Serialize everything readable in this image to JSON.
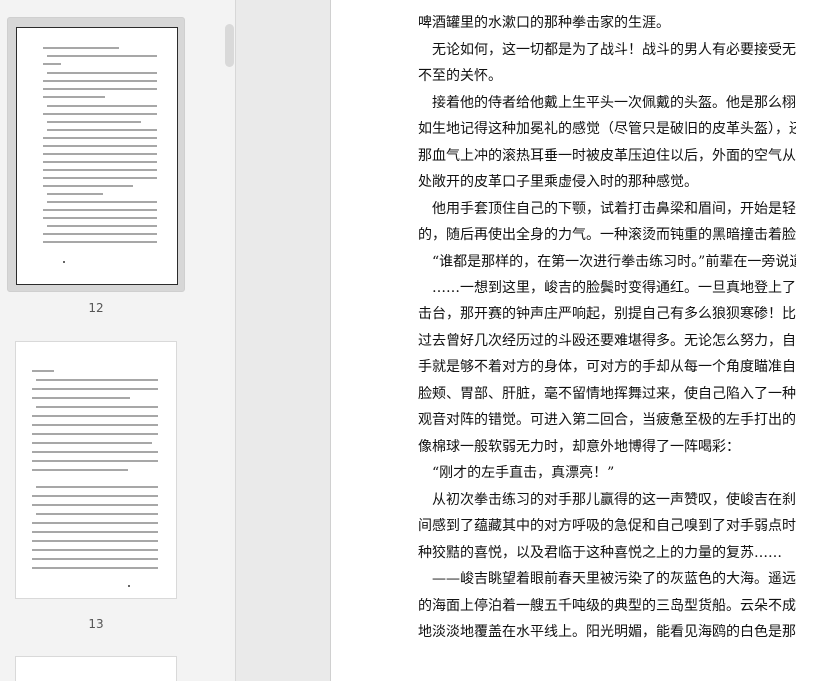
{
  "thumbnails": [
    {
      "label": "12",
      "selected": true
    },
    {
      "label": "13",
      "selected": false
    }
  ],
  "document": {
    "lines": [
      "啤酒罐里的水漱口的那种拳击家的生涯。",
      "　无论如何，这一切都是为了战斗！战斗的男人有必要接受无微",
      "不至的关怀。",
      "　接着他的侍者给他戴上生平头一次佩戴的头盔。他是那么栩栩",
      "如生地记得这种加冕礼的感觉（尽管只是破旧的皮革头盔），还有当",
      "那血气上冲的滚热耳垂一时被皮革压迫住以后，外面的空气从耳朵",
      "处敞开的皮革口子里乘虚侵入时的那种感觉。",
      "　他用手套顶住自己的下颚，试着打击鼻梁和眉间，开始是轻轻",
      "的，随后再使出全身的力气。一种滚烫而钝重的黑暗撞击着脸颊。",
      "　“谁都是那样的，在第一次进行拳击练习时。”前辈在一旁说道。",
      "　……一想到这里，峻吉的脸鬓时变得通红。一旦真地登上了拳",
      "击台，那开赛的钟声庄严响起，别提自己有多么狼狈寒碜！比自己",
      "过去曾好几次经历过的斗殴还要难堪得多。无论怎么努力，自己的",
      "手就是够不着对方的身体，可对方的手却从每一个角度瞄准自己的",
      "脸颊、胃部、肝脏，毫不留情地挥舞过来，使自己陷入了一种与千手",
      "观音对阵的错觉。可进入第二回合，当疲惫至极的左手打出的直击",
      "像棉球一般软弱无力时，却意外地博得了一阵喝彩：",
      "　“刚才的左手直击，真漂亮！”",
      "　从初次拳击练习的对手那儿赢得的这一声赞叹，使峻吉在刹那",
      "间感到了蕴藏其中的对方呼吸的急促和自己嗅到了对手弱点时的那",
      "种狡黠的喜悦，以及君临于这种喜悦之上的力量的复苏……",
      "　——峻吉眺望着眼前春天里被污染了的灰蓝色的大海。遥远",
      "的海面上停泊着一艘五千吨级的典型的三岛型货船。云朵不成形",
      "地淡淡地覆盖在水平线上。阳光明媚，能看见海鸥的白色是那么"
    ]
  }
}
